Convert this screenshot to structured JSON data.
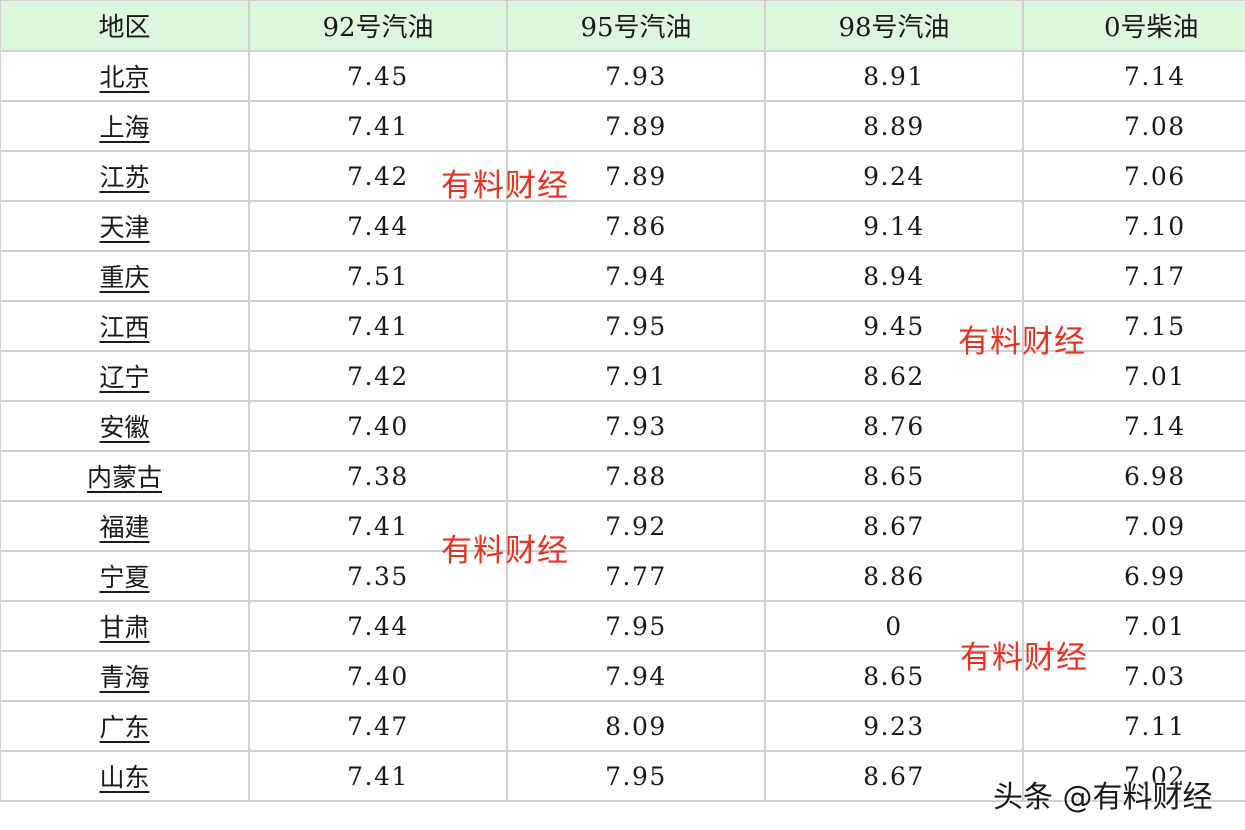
{
  "headers": [
    "地区",
    "92号汽油",
    "95号汽油",
    "98号汽油",
    "0号柴油"
  ],
  "rows": [
    {
      "region": "北京",
      "p92": "7.45",
      "p95": "7.93",
      "p98": "8.91",
      "d0": "7.14"
    },
    {
      "region": "上海",
      "p92": "7.41",
      "p95": "7.89",
      "p98": "8.89",
      "d0": "7.08"
    },
    {
      "region": "江苏",
      "p92": "7.42",
      "p95": "7.89",
      "p98": "9.24",
      "d0": "7.06"
    },
    {
      "region": "天津",
      "p92": "7.44",
      "p95": "7.86",
      "p98": "9.14",
      "d0": "7.10"
    },
    {
      "region": "重庆",
      "p92": "7.51",
      "p95": "7.94",
      "p98": "8.94",
      "d0": "7.17"
    },
    {
      "region": "江西",
      "p92": "7.41",
      "p95": "7.95",
      "p98": "9.45",
      "d0": "7.15"
    },
    {
      "region": "辽宁",
      "p92": "7.42",
      "p95": "7.91",
      "p98": "8.62",
      "d0": "7.01"
    },
    {
      "region": "安徽",
      "p92": "7.40",
      "p95": "7.93",
      "p98": "8.76",
      "d0": "7.14"
    },
    {
      "region": "内蒙古",
      "p92": "7.38",
      "p95": "7.88",
      "p98": "8.65",
      "d0": "6.98"
    },
    {
      "region": "福建",
      "p92": "7.41",
      "p95": "7.92",
      "p98": "8.67",
      "d0": "7.09"
    },
    {
      "region": "宁夏",
      "p92": "7.35",
      "p95": "7.77",
      "p98": "8.86",
      "d0": "6.99"
    },
    {
      "region": "甘肃",
      "p92": "7.44",
      "p95": "7.95",
      "p98": "0",
      "d0": "7.01"
    },
    {
      "region": "青海",
      "p92": "7.40",
      "p95": "7.94",
      "p98": "8.65",
      "d0": "7.03"
    },
    {
      "region": "广东",
      "p92": "7.47",
      "p95": "8.09",
      "p98": "9.23",
      "d0": "7.11"
    },
    {
      "region": "山东",
      "p92": "7.41",
      "p95": "7.95",
      "p98": "8.67",
      "d0": "7.02"
    }
  ],
  "watermarks": [
    "有料财经",
    "有料财经",
    "有料财经",
    "有料财经"
  ],
  "credit": "头条 @有料财经",
  "colors": {
    "header_bg": "#dcf7dc",
    "grid": "#cfcfcf",
    "watermark": "#e8311f"
  }
}
